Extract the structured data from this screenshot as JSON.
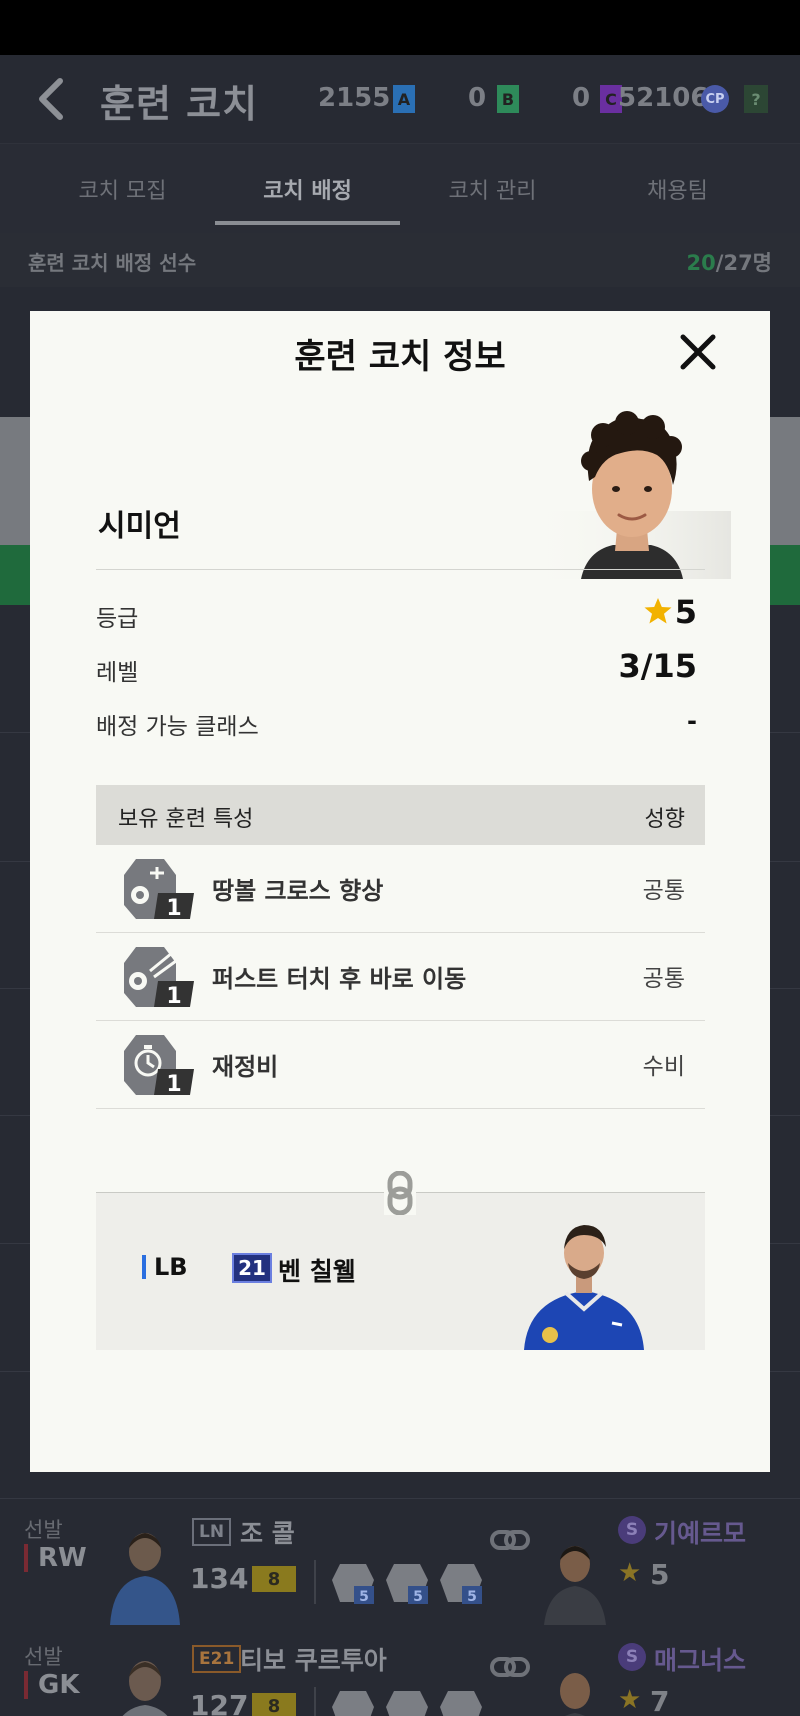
{
  "header": {
    "title": "훈련 코치",
    "currencies": [
      {
        "value": "21551",
        "badge": "A",
        "color": "#2a6fb4"
      },
      {
        "value": "0",
        "badge": "B",
        "color": "#2e8a5a"
      },
      {
        "value": "0",
        "badge": "C",
        "color": "#6a2fa0"
      }
    ],
    "coin_value": "52106",
    "coin_badge": "CP",
    "help": "?"
  },
  "tabs": [
    {
      "label": "코치 모집"
    },
    {
      "label": "코치 배정"
    },
    {
      "label": "코치 관리"
    },
    {
      "label": "채용팀"
    }
  ],
  "section": {
    "label": "훈련 코치 배정 선수",
    "count_current": "20",
    "count_rest": "/27명"
  },
  "background_rows": [
    {
      "role": "선발",
      "pos": "RW",
      "tag": "LN",
      "name": "조 콜",
      "ovr": "134",
      "level": "8",
      "trait_levels": [
        "5",
        "5",
        "5"
      ],
      "coach_name": "기예르모",
      "coach_grade": "5",
      "coach_badge": "S"
    },
    {
      "role": "선발",
      "pos": "GK",
      "tag": "E21",
      "name": "티보 쿠르투아",
      "ovr": "127",
      "level": "8",
      "trait_levels": [
        "5",
        "5",
        "5"
      ],
      "coach_name": "매그너스",
      "coach_grade": "7",
      "coach_badge": "S"
    }
  ],
  "modal": {
    "title": "훈련 코치 정보",
    "coach_name": "시미언",
    "grade_label": "등급",
    "grade_value": "5",
    "level_label": "레벨",
    "level_value": "3/15",
    "class_label": "배정 가능 클래스",
    "class_value": "-",
    "traits_header": "보유 훈련 특성",
    "traits_header_right": "성향",
    "traits": [
      {
        "name": "땅볼 크로스 향상",
        "tendency": "공통",
        "level": "1",
        "icon": "ground-cross-trait-icon"
      },
      {
        "name": "퍼스트 터치 후 바로 이동",
        "tendency": "공통",
        "level": "1",
        "icon": "first-touch-trait-icon"
      },
      {
        "name": "재정비",
        "tendency": "수비",
        "level": "1",
        "icon": "reorganize-trait-icon"
      }
    ],
    "linked_player": {
      "position": "LB",
      "number": "21",
      "name": "벤 칠웰"
    }
  },
  "colors": {
    "accent_star": "#f2b200",
    "position_bar": "#2a6ee0",
    "number_badge": "#23317f"
  }
}
